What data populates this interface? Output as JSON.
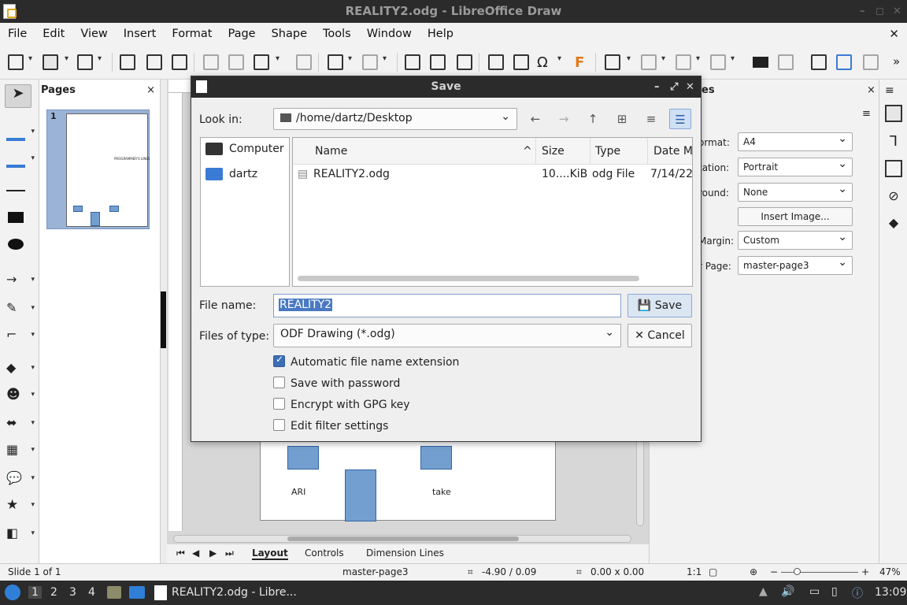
{
  "window": {
    "title": "REALITY2.odg - LibreOffice Draw"
  },
  "menubar": [
    "File",
    "Edit",
    "View",
    "Insert",
    "Format",
    "Page",
    "Shape",
    "Tools",
    "Window",
    "Help"
  ],
  "pages_pane": {
    "title": "Pages",
    "page_number": "1"
  },
  "canvas": {
    "shape_label_left": "ARI",
    "shape_label_right": "take",
    "thumb_title": "PROGRAMMER'S LINES"
  },
  "tabs": [
    "Layout",
    "Controls",
    "Dimension Lines"
  ],
  "properties": {
    "title": "es",
    "format_label": "ormat:",
    "format_value": "A4",
    "orientation_label": "tation:",
    "orientation_value": "Portrait",
    "background_label": "round:",
    "background_value": "None",
    "insert_image": "Insert Image...",
    "margin_label": "Margin:",
    "margin_value": "Custom",
    "master_label": "r Page:",
    "master_value": "master-page3"
  },
  "statusbar": {
    "slide": "Slide 1 of 1",
    "master": "master-page3",
    "position": "-4.90 / 0.09",
    "size": "0.00 x 0.00",
    "scale": "1:1",
    "zoom": "47%"
  },
  "taskbar": {
    "workspaces": [
      "1",
      "2",
      "3",
      "4"
    ],
    "task": "REALITY2.odg - Libre...",
    "clock": "13:09"
  },
  "dialog": {
    "title": "Save",
    "look_in_label": "Look in:",
    "look_in_value": "/home/dartz/Desktop",
    "places": [
      "Computer",
      "dartz"
    ],
    "columns": {
      "name": "Name",
      "size": "Size",
      "type": "Type",
      "date": "Date M"
    },
    "files": [
      {
        "name": "REALITY2.odg",
        "size": "10....KiB",
        "type": "odg File",
        "date": "7/14/22"
      }
    ],
    "file_name_label": "File name:",
    "file_name_value": "REALITY2",
    "files_of_type_label": "Files of type:",
    "files_of_type_value": "ODF Drawing (*.odg)",
    "save_button": "Save",
    "cancel_button": "Cancel",
    "options": [
      {
        "label": "Automatic file name extension",
        "checked": true
      },
      {
        "label": "Save with password",
        "checked": false
      },
      {
        "label": "Encrypt with GPG key",
        "checked": false
      },
      {
        "label": "Edit filter settings",
        "checked": false
      }
    ]
  }
}
